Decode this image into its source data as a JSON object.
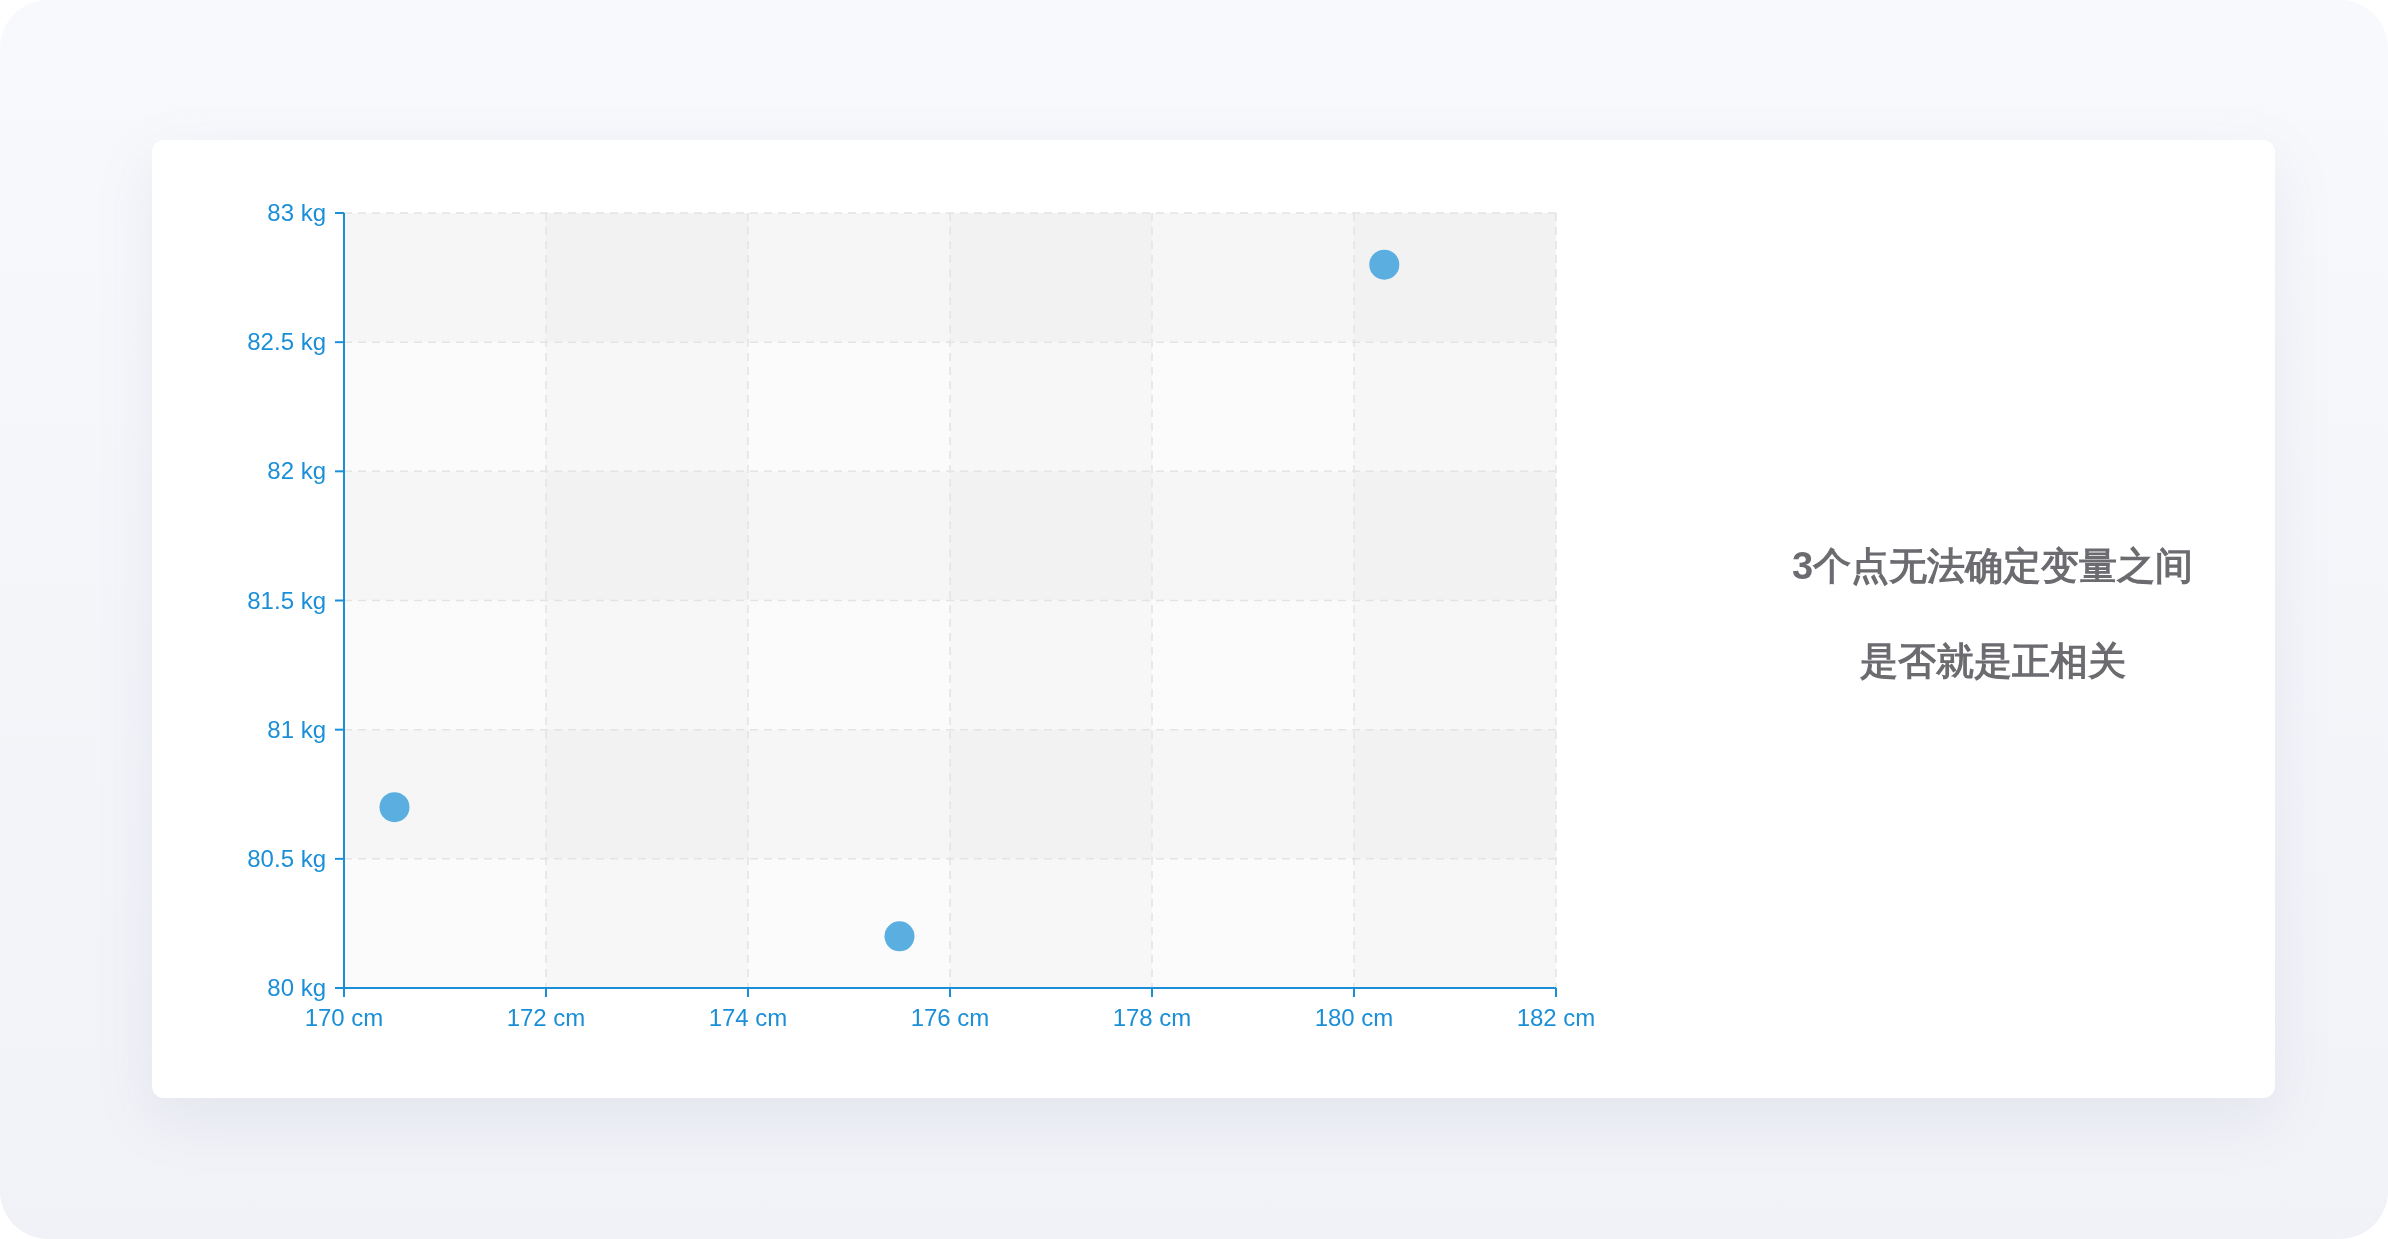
{
  "chart_data": {
    "type": "scatter",
    "x": [
      170.5,
      175.5,
      180.3
    ],
    "series": [
      {
        "color": "#5aafe0",
        "values": [
          80.7,
          80.2,
          82.8
        ]
      }
    ],
    "grid": true,
    "xlim": [
      170,
      182
    ],
    "ylim": [
      80,
      83
    ],
    "xticks": [
      {
        "value": 170,
        "label": "170 cm"
      },
      {
        "value": 172,
        "label": "172 cm"
      },
      {
        "value": 174,
        "label": "174 cm"
      },
      {
        "value": 176,
        "label": "176 cm"
      },
      {
        "value": 178,
        "label": "178 cm"
      },
      {
        "value": 180,
        "label": "180 cm"
      },
      {
        "value": 182,
        "label": "182 cm"
      }
    ],
    "yticks": [
      {
        "value": 80,
        "label": "80 kg"
      },
      {
        "value": 80.5,
        "label": "80.5 kg"
      },
      {
        "value": 81,
        "label": "81 kg"
      },
      {
        "value": 81.5,
        "label": "81.5 kg"
      },
      {
        "value": 82,
        "label": "82 kg"
      },
      {
        "value": 82.5,
        "label": "82.5 kg"
      },
      {
        "value": 83,
        "label": "83 kg"
      }
    ]
  },
  "caption": [
    "3个点无法确定变量之间",
    "是否就是正相关"
  ]
}
